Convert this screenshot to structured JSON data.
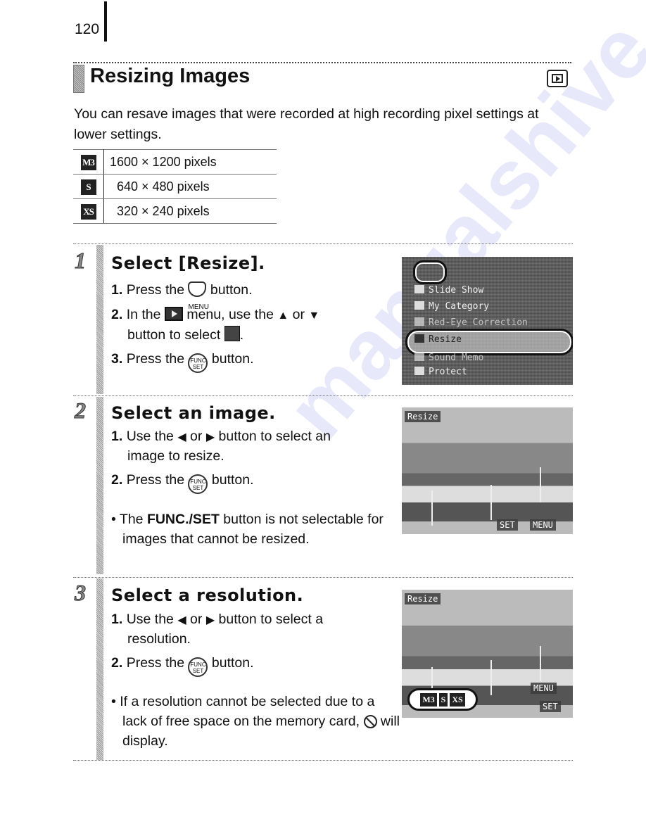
{
  "page_number": "120",
  "title": "Resizing Images",
  "mode_icon": "playback-mode-icon",
  "intro": "You can resave images that were recorded at high recording pixel settings at lower settings.",
  "resolutions": [
    {
      "badge": "M3",
      "label": "1600 × 1200 pixels"
    },
    {
      "badge": "S",
      "label": "640 × 480 pixels"
    },
    {
      "badge": "XS",
      "label": "320 × 240 pixels"
    }
  ],
  "steps": [
    {
      "number": "1",
      "title": "Select [Resize].",
      "lines": {
        "l1_num": "1.",
        "l1_a": "Press the",
        "l1_icon_label": "MENU",
        "l1_b": "button.",
        "l2_num": "2.",
        "l2_a": "In the",
        "l2_b": "menu, use the",
        "l2_up": "▲",
        "l2_or": "or",
        "l2_down": "▼",
        "l2_cont": "button to select",
        "l2_end": ".",
        "l3_num": "3.",
        "l3_a": "Press the",
        "l3_icon_top": "FUNC",
        "l3_icon_bottom": "SET",
        "l3_b": "button."
      },
      "screen": {
        "menu_items": [
          "Slide Show",
          "My Category",
          "Red-Eye Correction",
          "Resize",
          "Sound Memo",
          "Protect"
        ],
        "selected": "Resize"
      }
    },
    {
      "number": "2",
      "title": "Select an image.",
      "lines": {
        "l1_num": "1.",
        "l1_a": "Use the",
        "l1_left": "◀",
        "l1_or": "or",
        "l1_right": "▶",
        "l1_b": "button to select an",
        "l1_cont": "image to resize.",
        "l2_num": "2.",
        "l2_a": "Press the",
        "l2_icon_top": "FUNC",
        "l2_icon_bottom": "SET",
        "l2_b": "button."
      },
      "note_prefix": "The ",
      "note_bold": "FUNC./SET",
      "note_suffix": " button is not selectable for images that cannot be resized.",
      "screen": {
        "header": "Resize",
        "set_label": "SET",
        "menu_label": "MENU"
      }
    },
    {
      "number": "3",
      "title": "Select a resolution.",
      "lines": {
        "l1_num": "1.",
        "l1_a": "Use the",
        "l1_left": "◀",
        "l1_or": "or",
        "l1_right": "▶",
        "l1_b": "button to select a",
        "l1_cont": "resolution.",
        "l2_num": "2.",
        "l2_a": "Press the",
        "l2_icon_top": "FUNC",
        "l2_icon_bottom": "SET",
        "l2_b": "button."
      },
      "note_a": "If a resolution cannot be selected due to a lack of free space on the memory card,",
      "note_b": "will display.",
      "screen": {
        "header": "Resize",
        "options": [
          "M3",
          "S",
          "XS"
        ],
        "menu_label": "MENU",
        "set_label": "SET"
      }
    }
  ],
  "watermark": "manualshive"
}
